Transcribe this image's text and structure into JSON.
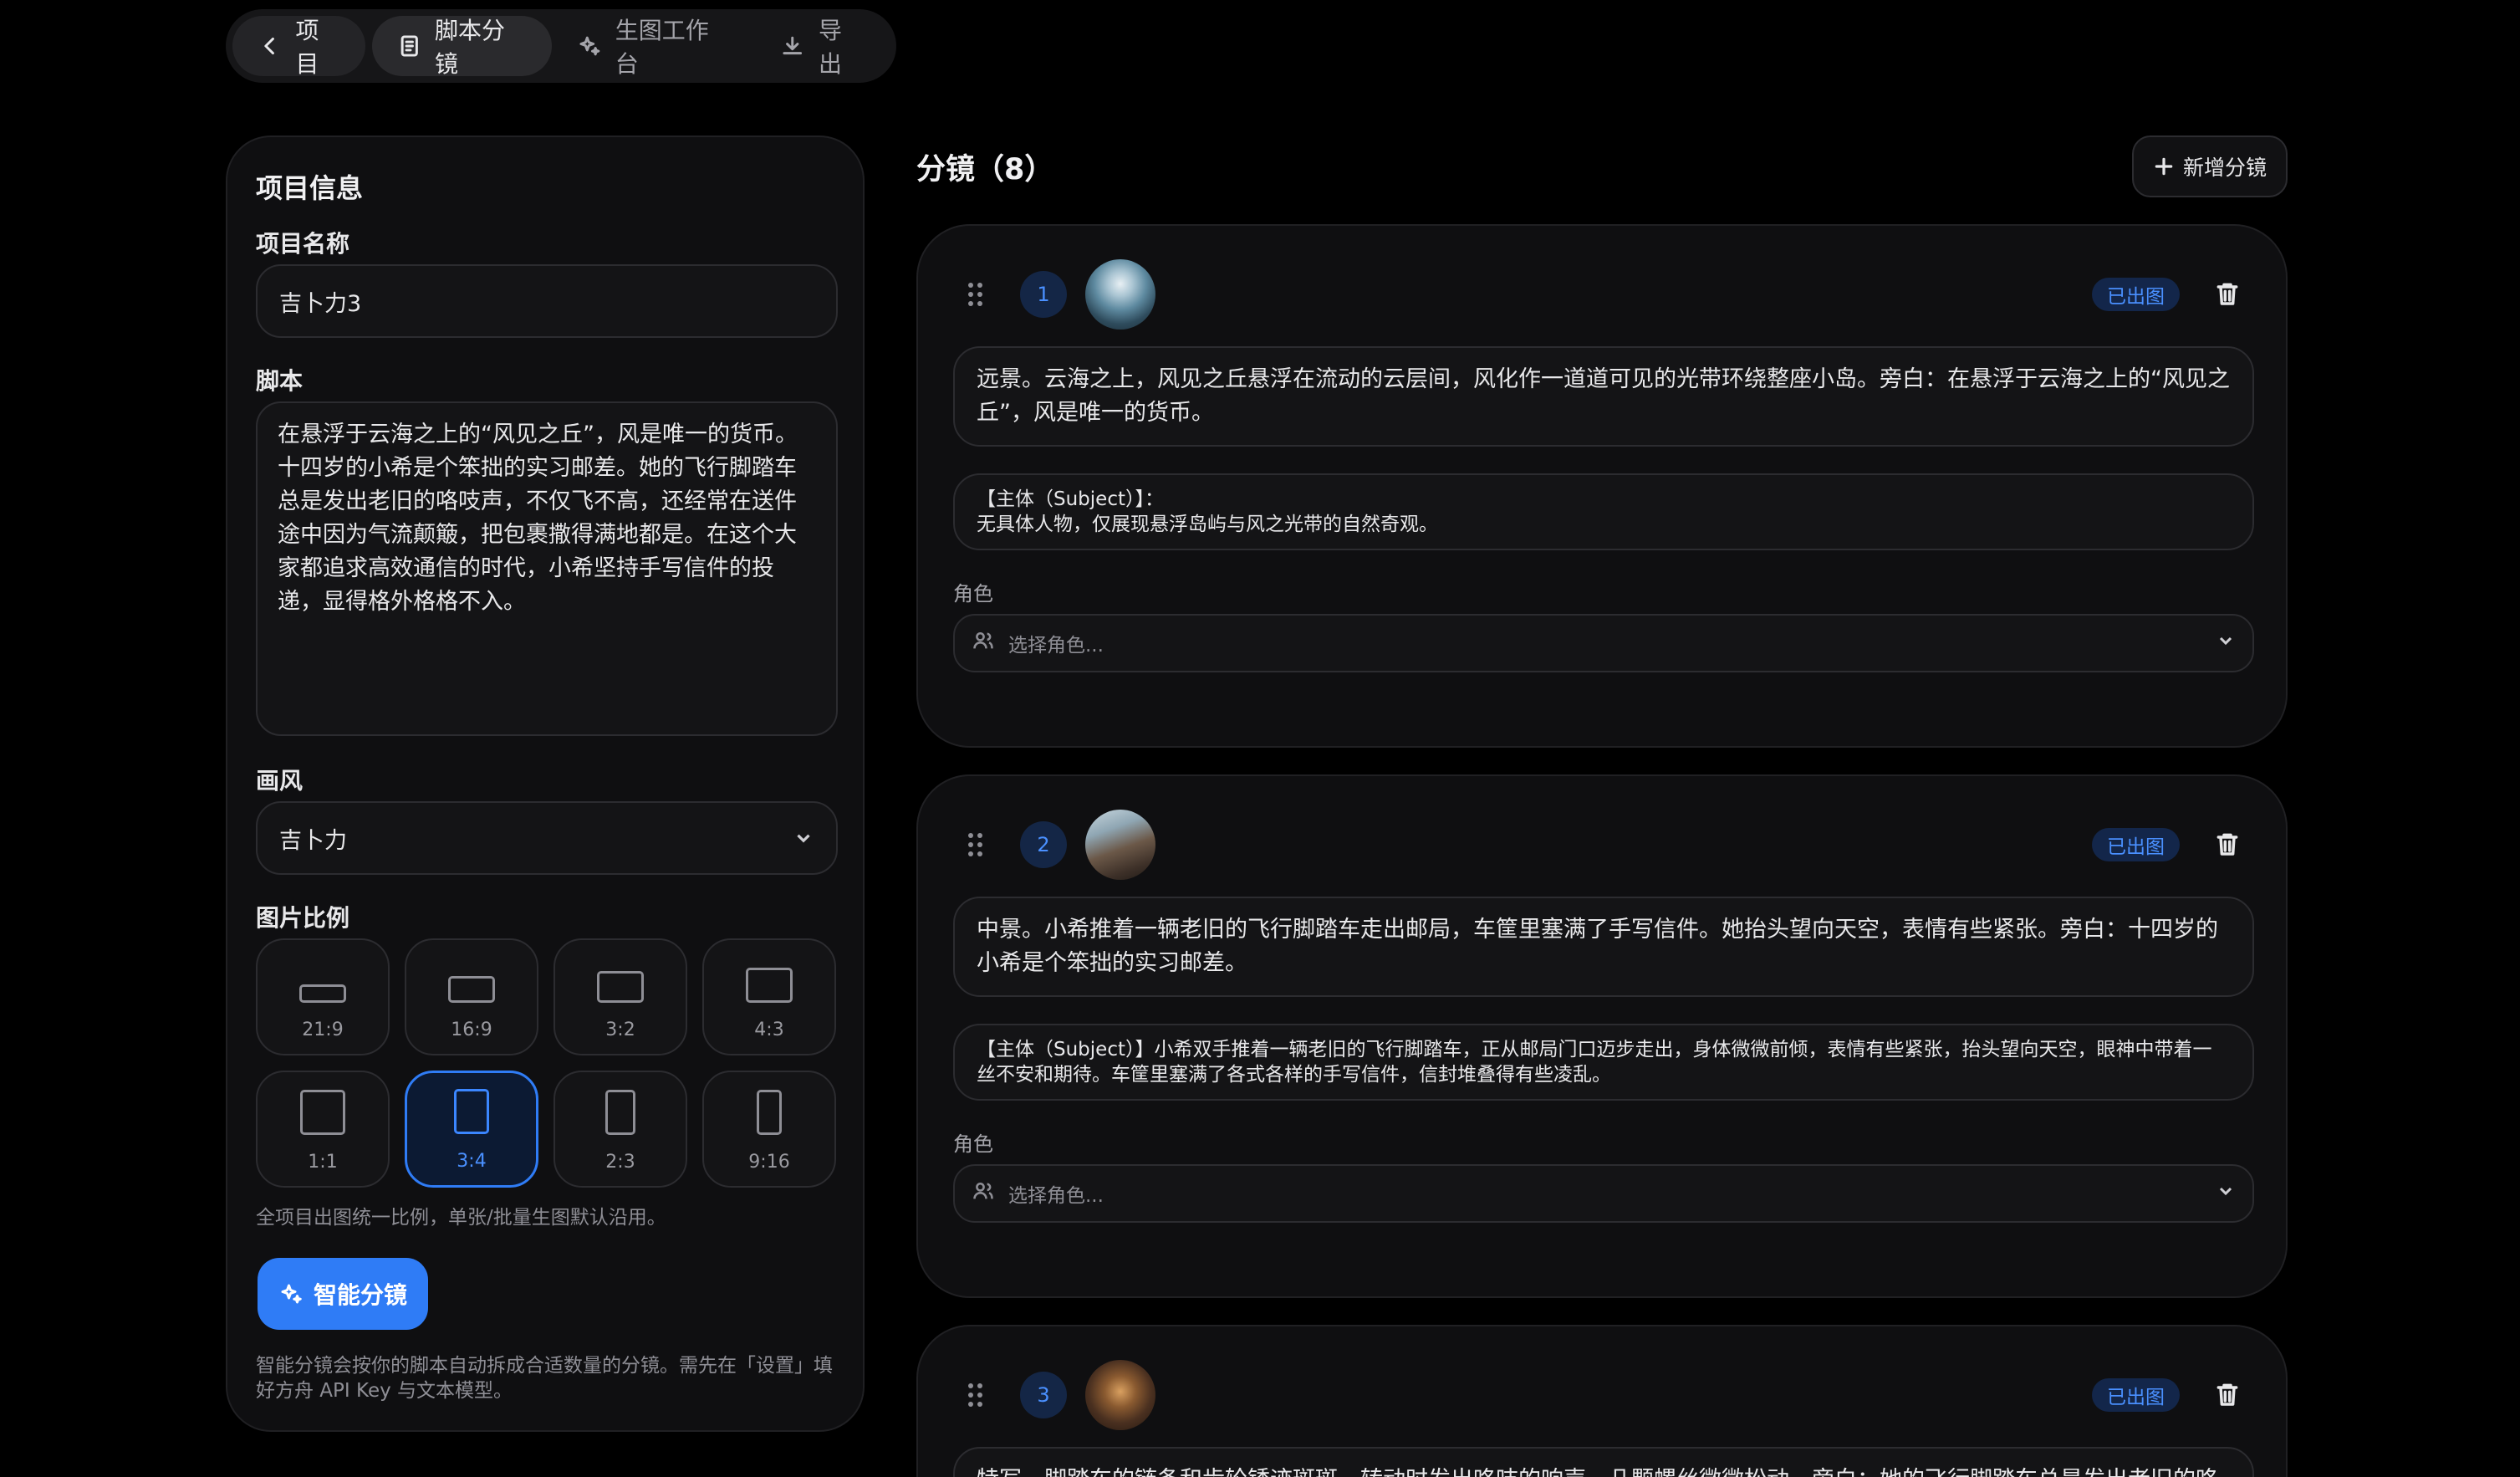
{
  "nav": {
    "back_label": "项目",
    "tabs": [
      {
        "label": "脚本分镜",
        "active": true
      },
      {
        "label": "生图工作台",
        "active": false
      },
      {
        "label": "导出",
        "active": false
      }
    ]
  },
  "project": {
    "panel_title": "项目信息",
    "name_label": "项目名称",
    "name_value": "吉卜力3",
    "script_label": "脚本",
    "script_value": "在悬浮于云海之上的“风见之丘”，风是唯一的货币。十四岁的小希是个笨拙的实习邮差。她的飞行脚踏车总是发出老旧的咯吱声，不仅飞不高，还经常在送件途中因为气流颠簸，把包裹撒得满地都是。在这个大家都追求高效通信的时代，小希坚持手写信件的投递，显得格外格格不入。",
    "style_label": "画风",
    "style_value": "吉卜力",
    "ratio_label": "图片比例",
    "ratios": [
      {
        "label": "21:9",
        "selected": false
      },
      {
        "label": "16:9",
        "selected": false
      },
      {
        "label": "3:2",
        "selected": false
      },
      {
        "label": "4:3",
        "selected": false
      },
      {
        "label": "1:1",
        "selected": false
      },
      {
        "label": "3:4",
        "selected": true
      },
      {
        "label": "2:3",
        "selected": false
      },
      {
        "label": "9:16",
        "selected": false
      }
    ],
    "ratio_note": "全项目出图统一比例，单张/批量生图默认沿用。",
    "smart_button": "智能分镜",
    "smart_note": "智能分镜会按你的脚本自动拆成合适数量的分镜。需先在「设置」填好方舟 API Key 与文本模型。"
  },
  "storyboard": {
    "title": "分镜（8）",
    "add_button": "新增分镜",
    "role_label": "角色",
    "role_placeholder": "选择角色...",
    "status_done": "已出图",
    "shots": [
      {
        "index": "1",
        "status": "已出图",
        "description": "远景。云海之上，风见之丘悬浮在流动的云层间，风化作一道道可见的光带环绕整座小岛。旁白：在悬浮于云海之上的“风见之丘”，风是唯一的货币。",
        "prompt": "【主体（Subject）】：\n无具体人物，仅展现悬浮岛屿与风之光带的自然奇观。"
      },
      {
        "index": "2",
        "status": "已出图",
        "description": "中景。小希推着一辆老旧的飞行脚踏车走出邮局，车筐里塞满了手写信件。她抬头望向天空，表情有些紧张。旁白：十四岁的小希是个笨拙的实习邮差。",
        "prompt": "【主体（Subject）】小希双手推着一辆老旧的飞行脚踏车，正从邮局门口迈步走出，身体微微前倾，表情有些紧张，抬头望向天空，眼神中带着一丝不安和期待。车筐里塞满了各式各样的手写信件，信封堆叠得有些凌乱。"
      },
      {
        "index": "3",
        "status": "已出图",
        "description": "特写。脚踏车的链条和齿轮锈迹斑斑，转动时发出咯吱的响声，几颗螺丝微微松动。旁白：她的飞行脚踏车总是发出老旧的咯吱声。",
        "prompt": ""
      }
    ]
  },
  "colors": {
    "accent": "#2f7cf6",
    "background": "#000000",
    "panel": "#0f0f11",
    "badge_bg": "#13264a"
  }
}
